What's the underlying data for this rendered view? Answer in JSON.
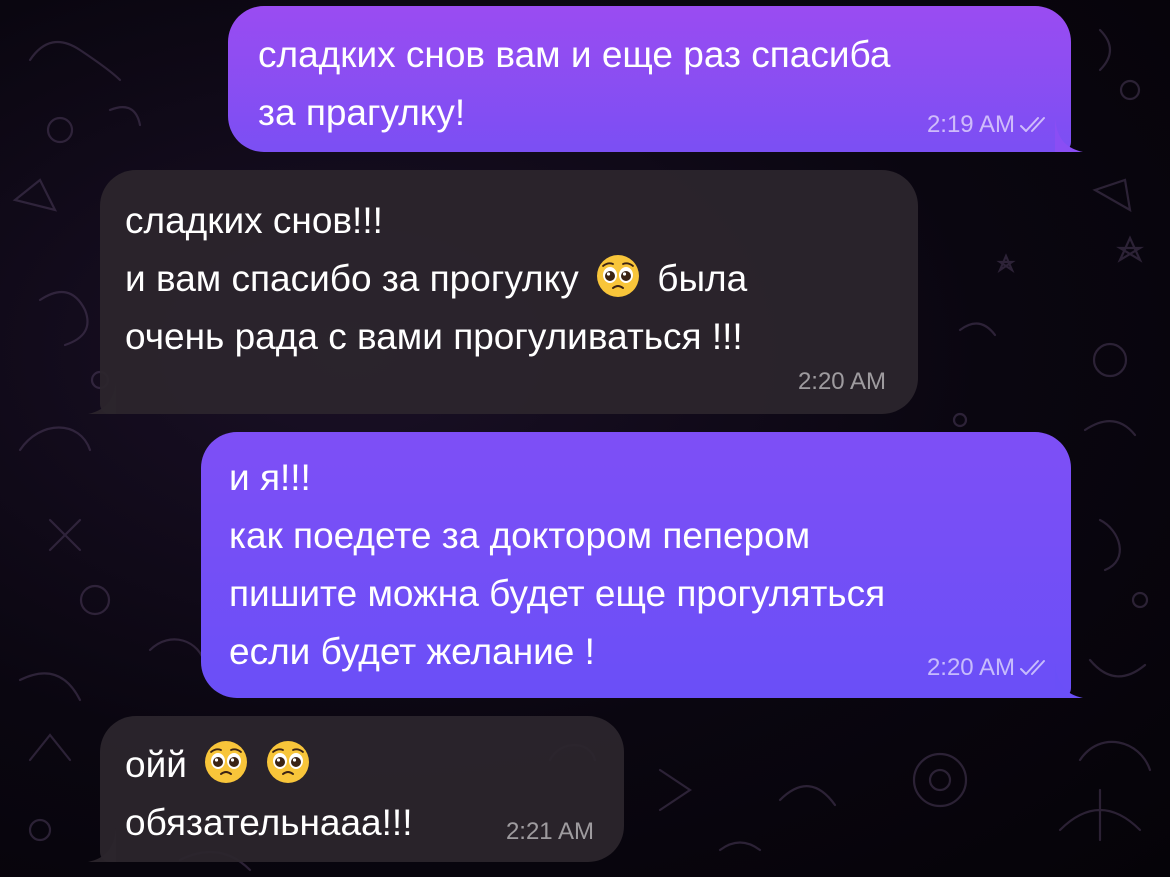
{
  "messages": [
    {
      "direction": "outgoing",
      "lines": [
        "сладких снов вам и еще раз спасиба",
        "за прагулку!"
      ],
      "time": "2:19 AM",
      "status_icon": "double-check-icon"
    },
    {
      "direction": "incoming",
      "lines": [
        "сладких снов!!!",
        "и вам спасибо за прогулку",
        "была",
        "очень рада с вами прогуливаться !!!"
      ],
      "emoji": "pleading-face-emoji",
      "time": "2:20 AM"
    },
    {
      "direction": "outgoing",
      "lines": [
        "и я!!!",
        "как поедете за доктором пепером",
        "пишите можна будет еще прогуляться",
        "если будет желание !"
      ],
      "time": "2:20 AM",
      "status_icon": "double-check-icon"
    },
    {
      "direction": "incoming",
      "lines": [
        "ойй",
        "обязательнааа!!!"
      ],
      "emoji": "pleading-face-emoji",
      "time": "2:21 AM"
    }
  ],
  "colors": {
    "outgoing_top": "#9a4cf2",
    "outgoing_bottom": "#6a4ff7",
    "incoming": "#2c252d",
    "background": "#050308"
  }
}
